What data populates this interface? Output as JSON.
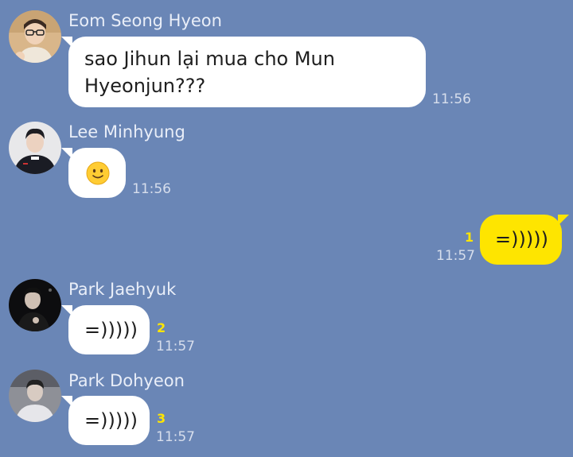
{
  "colors": {
    "background": "#6a86b6",
    "incoming_bubble": "#ffffff",
    "outgoing_bubble": "#fee500",
    "unread_count": "#fee500"
  },
  "messages": [
    {
      "sender": "Eom Seong Hyeon",
      "text_line1": "sao Jihun lại mua cho Mun",
      "text_line2": "Hyeonjun???",
      "time": "11:56",
      "avatar_icon": "avatar-glasses-icon"
    },
    {
      "sender": "Lee Minhyung",
      "emoji": "slightly-smiling-face-icon",
      "time": "11:56",
      "avatar_icon": "avatar-dark-jacket-icon"
    },
    {
      "sender": "",
      "text": "=)))))",
      "time": "11:57",
      "unread": "1",
      "outgoing": true
    },
    {
      "sender": "Park Jaehyuk",
      "text": "=)))))",
      "time": "11:57",
      "unread": "2",
      "avatar_icon": "avatar-dark-photo-icon"
    },
    {
      "sender": "Park Dohyeon",
      "text": "=)))))",
      "time": "11:57",
      "unread": "3",
      "avatar_icon": "avatar-grey-photo-icon"
    }
  ]
}
